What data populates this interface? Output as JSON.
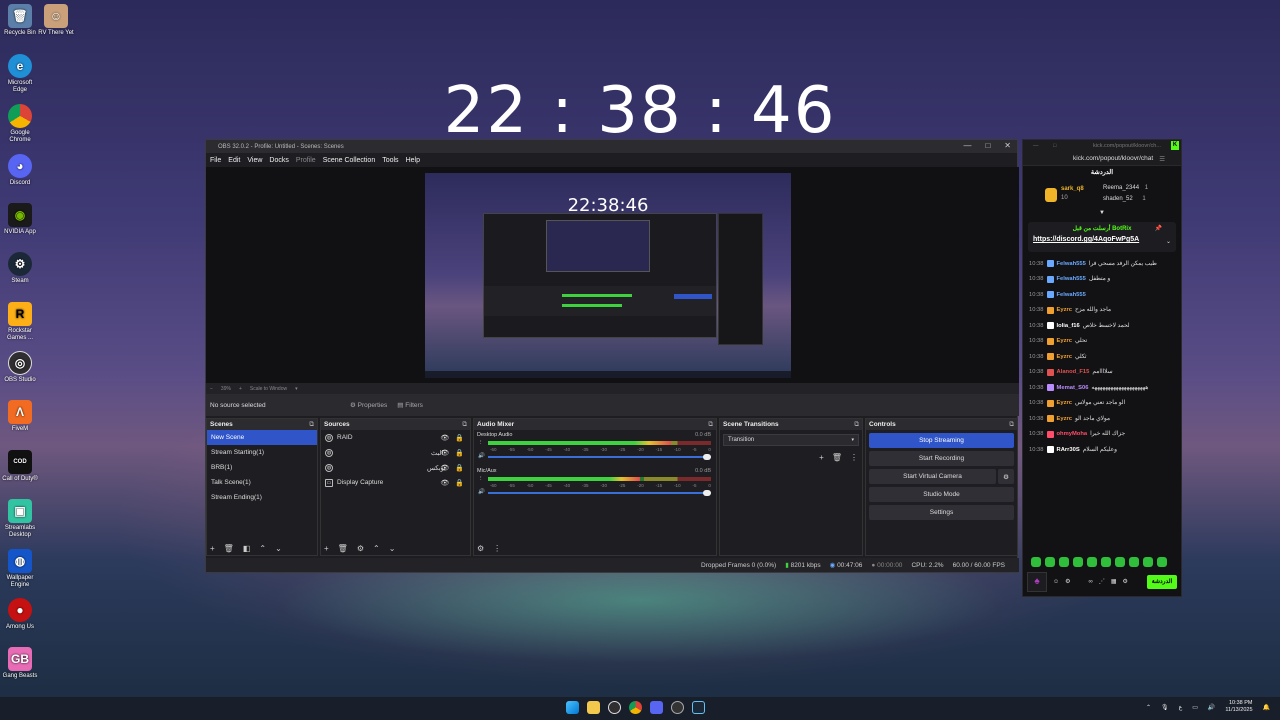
{
  "desktop": {
    "icons": [
      "Recycle Bin",
      "RV There Yet",
      "Microsoft Edge",
      "Google Chrome",
      "Discord",
      "NVIDIA App",
      "Steam",
      "Rockstar Games ...",
      "OBS Studio",
      "FiveM",
      "Call of Duty®",
      "Streamlabs Desktop",
      "Wallpaper Engine",
      "Among Us",
      "Gang Beasts"
    ],
    "clock": "22 : 38 : 46"
  },
  "obs": {
    "title": "OBS 32.0.2 - Profile: Untitled - Scenes: Scenes",
    "menu": [
      "File",
      "Edit",
      "View",
      "Docks",
      "Profile",
      "Scene Collection",
      "Tools",
      "Help"
    ],
    "preview_clock": "22:38:46",
    "zoom": "39%",
    "scale_mode": "Scale to Window",
    "no_source": "No source selected",
    "properties": "Properties",
    "filters": "Filters",
    "scenes_title": "Scenes",
    "scenes": [
      "New Scene",
      "Stream Starting(1)",
      "BRB(1)",
      "Talk Scene(1)",
      "Stream Ending(1)"
    ],
    "sources_title": "Sources",
    "sources": [
      "RAID",
      "البث",
      "توبكس",
      "Display Capture"
    ],
    "mixer_title": "Audio Mixer",
    "channels": [
      {
        "name": "Desktop Audio",
        "db": "0.0 dB",
        "level": 0.82
      },
      {
        "name": "Mic/Aux",
        "db": "0.0 dB",
        "level": 0.68
      }
    ],
    "ticks": [
      "-60",
      "-55",
      "-50",
      "-45",
      "-40",
      "-35",
      "-30",
      "-25",
      "-20",
      "-15",
      "-10",
      "-5",
      "0"
    ],
    "transitions_title": "Scene Transitions",
    "transition": "Transition",
    "controls_title": "Controls",
    "controls": {
      "stop_streaming": "Stop Streaming",
      "start_recording": "Start Recording",
      "start_virtual_camera": "Start Virtual Camera",
      "studio_mode": "Studio Mode",
      "settings": "Settings"
    },
    "status": {
      "dropped": "Dropped Frames 0 (0.0%)",
      "kbps": "8201 kbps",
      "stream_time": "00:47:06",
      "rec_time": "00:00:00",
      "cpu": "CPU: 2.2%",
      "fps": "60.00 / 60.00 FPS"
    }
  },
  "chat": {
    "window_title": "kick.com/popout/kloovr/ch...",
    "url": "kick.com/popout/kloovr/chat",
    "header": "الدردشة",
    "leaders": [
      {
        "name": "sark_q8",
        "count": "10"
      },
      {
        "name": "Reema_2344",
        "count": "1"
      },
      {
        "name": "shaden_52",
        "count": "1"
      }
    ],
    "pinned_by": "أرسلت من قبل BotRix",
    "pinned_link": "https://discord.gg/4AqoFwPg5A",
    "messages": [
      {
        "time": "10:38",
        "user": "Felwah555",
        "text": "طيب يمكن الرفد مسحي فرا",
        "color": "#6aa9ff"
      },
      {
        "time": "10:38",
        "user": "Felwah555",
        "text": "و متطفل",
        "color": "#6aa9ff"
      },
      {
        "time": "10:38",
        "user": "Felwah555",
        "text": "",
        "color": "#6aa9ff"
      },
      {
        "time": "10:38",
        "user": "Eyzrc",
        "text": "ماجد والله مزح",
        "color": "#f0a030"
      },
      {
        "time": "10:38",
        "user": "lolia_f16",
        "text": "لحمد لاخسط خلاص",
        "color": "#ffffff"
      },
      {
        "time": "10:38",
        "user": "Eyzrc",
        "text": "تحلي",
        "color": "#f0a030"
      },
      {
        "time": "10:38",
        "user": "Eyzrc",
        "text": "ثكلي",
        "color": "#f0a030"
      },
      {
        "time": "10:38",
        "user": "Alanod_F15",
        "text": "سلاااامم",
        "color": "#e05252"
      },
      {
        "time": "10:38",
        "user": "Memat_S06",
        "text": "ههههههههههههههههههههه",
        "color": "#b98cff"
      },
      {
        "time": "10:38",
        "user": "Eyzrc",
        "text": "الو ماجد تعني مولاس",
        "color": "#f0a030"
      },
      {
        "time": "10:38",
        "user": "Eyzrc",
        "text": "مولاي ماجد الو",
        "color": "#f0a030"
      },
      {
        "time": "10:38",
        "user": "ohmyMoha",
        "text": "جزاك الله خيرا",
        "color": "#ff4d6a"
      },
      {
        "time": "10:38",
        "user": "RArr30S",
        "text": "وعليكم السلام",
        "color": "#ffffff"
      }
    ],
    "send": "الدردشة"
  },
  "taskbar": {
    "lang": "ع",
    "time": "10:38 PM",
    "date": "11/13/2025"
  }
}
